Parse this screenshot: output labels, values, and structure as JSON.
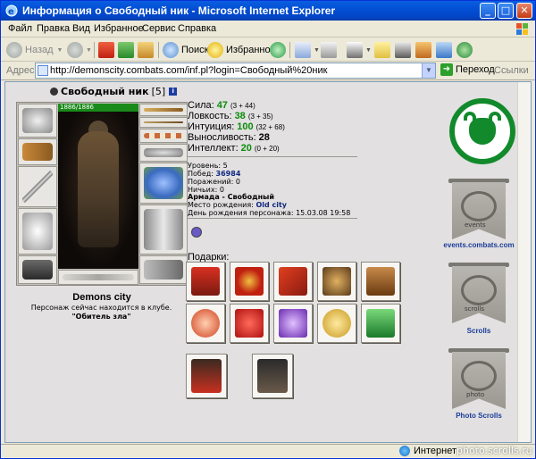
{
  "window": {
    "title": "Информация о Свободный ник - Microsoft Internet Explorer"
  },
  "menu": [
    "Файл",
    "Правка",
    "Вид",
    "Избранное",
    "Сервис",
    "Справка"
  ],
  "toolbar": {
    "back_label": "Назад",
    "search_label": "Поиск",
    "favorites_label": "Избранное"
  },
  "address": {
    "label": "Адрес:",
    "url": "http://demonscity.combats.com/inf.pl?login=Свободный%20ник",
    "go_label": "Переход",
    "links_label": "Ссылки"
  },
  "status": {
    "zone_label": "Интернет"
  },
  "watermark": "photo.scrolls.ru",
  "character": {
    "name": "Свободный ник",
    "level_badge": "[5]",
    "hp": "1886/1886",
    "city": "Demons city",
    "club_text": "Персонаж сейчас находится в клубе.",
    "club_room": "\"Обитель зла\""
  },
  "stats": [
    {
      "label": "Сила:",
      "value": "47",
      "bonus": "(3 + 44)",
      "color": "#0a8c0a"
    },
    {
      "label": "Ловкость:",
      "value": "38",
      "bonus": "(3 + 35)",
      "color": "#0a8c0a"
    },
    {
      "label": "Интуиция:",
      "value": "100",
      "bonus": "(32 + 68)",
      "color": "#0a8c0a"
    },
    {
      "label": "Выносливость:",
      "value": "28",
      "bonus": "",
      "color": "#000000"
    },
    {
      "label": "Интеллект:",
      "value": "20",
      "bonus": "(0 + 20)",
      "color": "#0a8c0a"
    }
  ],
  "details": {
    "level": "Уровень: 5",
    "wins_label": "Побед:",
    "wins_value": "36984",
    "losses": "Поражений: 0",
    "draws": "Ничьих: 0",
    "clan_label": "Армада - Свободный",
    "birthplace_label": "Место рождения:",
    "birthplace_value": "Old city",
    "birthday": "День рождения персонажа: 15.03.08 19:58"
  },
  "gifts": {
    "label": "Подарки:"
  },
  "emblems": {
    "events_link": "events.combats.com",
    "scrolls_link": "Scrolls",
    "photo_link": "Photo Scrolls",
    "events_text": "events",
    "scrolls_text": "scrolls",
    "photo_text": "photo"
  },
  "colors": {
    "accent_green": "#128a2c",
    "link_blue": "#1a3c9a",
    "xp_blue": "#0245c8"
  }
}
